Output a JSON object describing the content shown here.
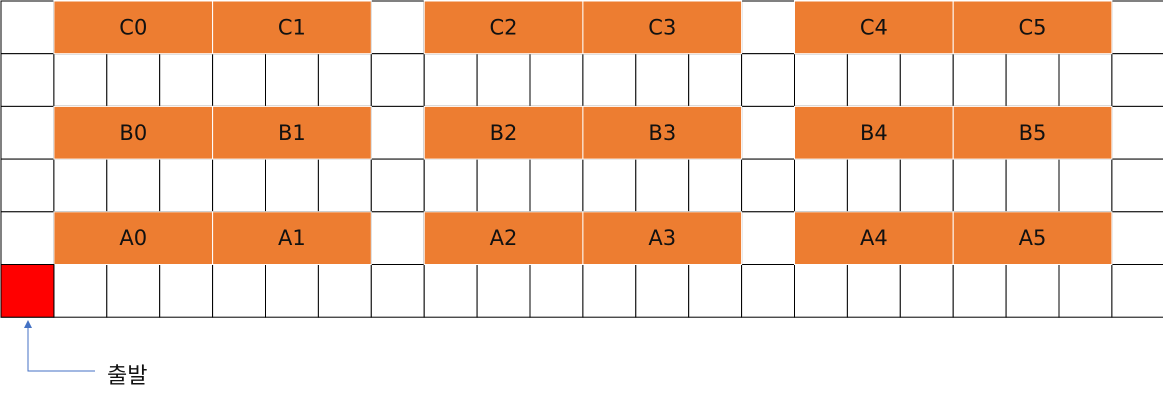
{
  "grid": {
    "columns": 22,
    "rows": 6
  },
  "blocks": {
    "row_c": [
      "C0",
      "C1",
      "C2",
      "C3",
      "C4",
      "C5"
    ],
    "row_b": [
      "B0",
      "B1",
      "B2",
      "B3",
      "B4",
      "B5"
    ],
    "row_a": [
      "A0",
      "A1",
      "A2",
      "A3",
      "A4",
      "A5"
    ]
  },
  "start": {
    "label": "출발"
  },
  "colors": {
    "block": "#ED7D31",
    "start": "#FF0000",
    "arrow": "#4472C4",
    "grid": "#000000"
  }
}
